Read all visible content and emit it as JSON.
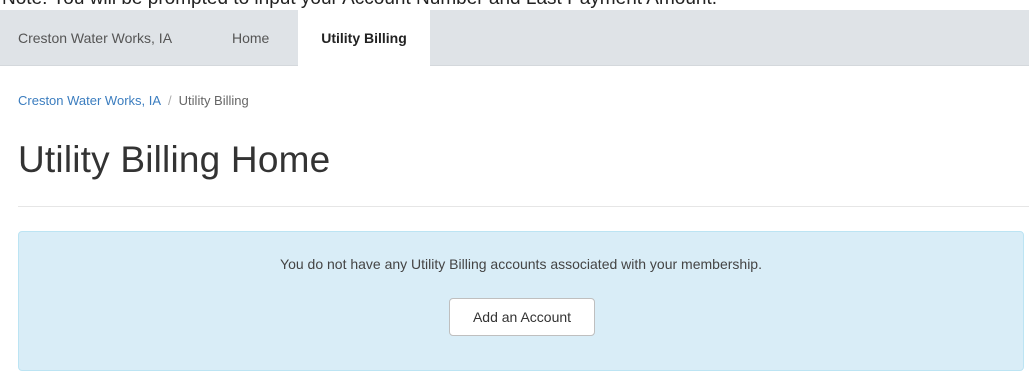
{
  "top_note": "Note: You will be prompted to input your Account Number and Last Payment Amount.",
  "navbar": {
    "brand": "Creston Water Works, IA",
    "links": [
      {
        "label": "Home"
      },
      {
        "label": "Utility Billing",
        "active": true
      }
    ]
  },
  "breadcrumb": {
    "items": [
      "Creston Water Works, IA",
      "Utility Billing"
    ],
    "separator": "/"
  },
  "main": {
    "title": "Utility Billing Home",
    "alert": {
      "message": "You do not have any Utility Billing accounts associated with your membership.",
      "button_label": "Add an Account"
    }
  },
  "colors": {
    "navbar_bg": "#dfe3e7",
    "link": "#3b7dbf",
    "alert_bg": "#d9edf7",
    "alert_border": "#bce4f3"
  }
}
